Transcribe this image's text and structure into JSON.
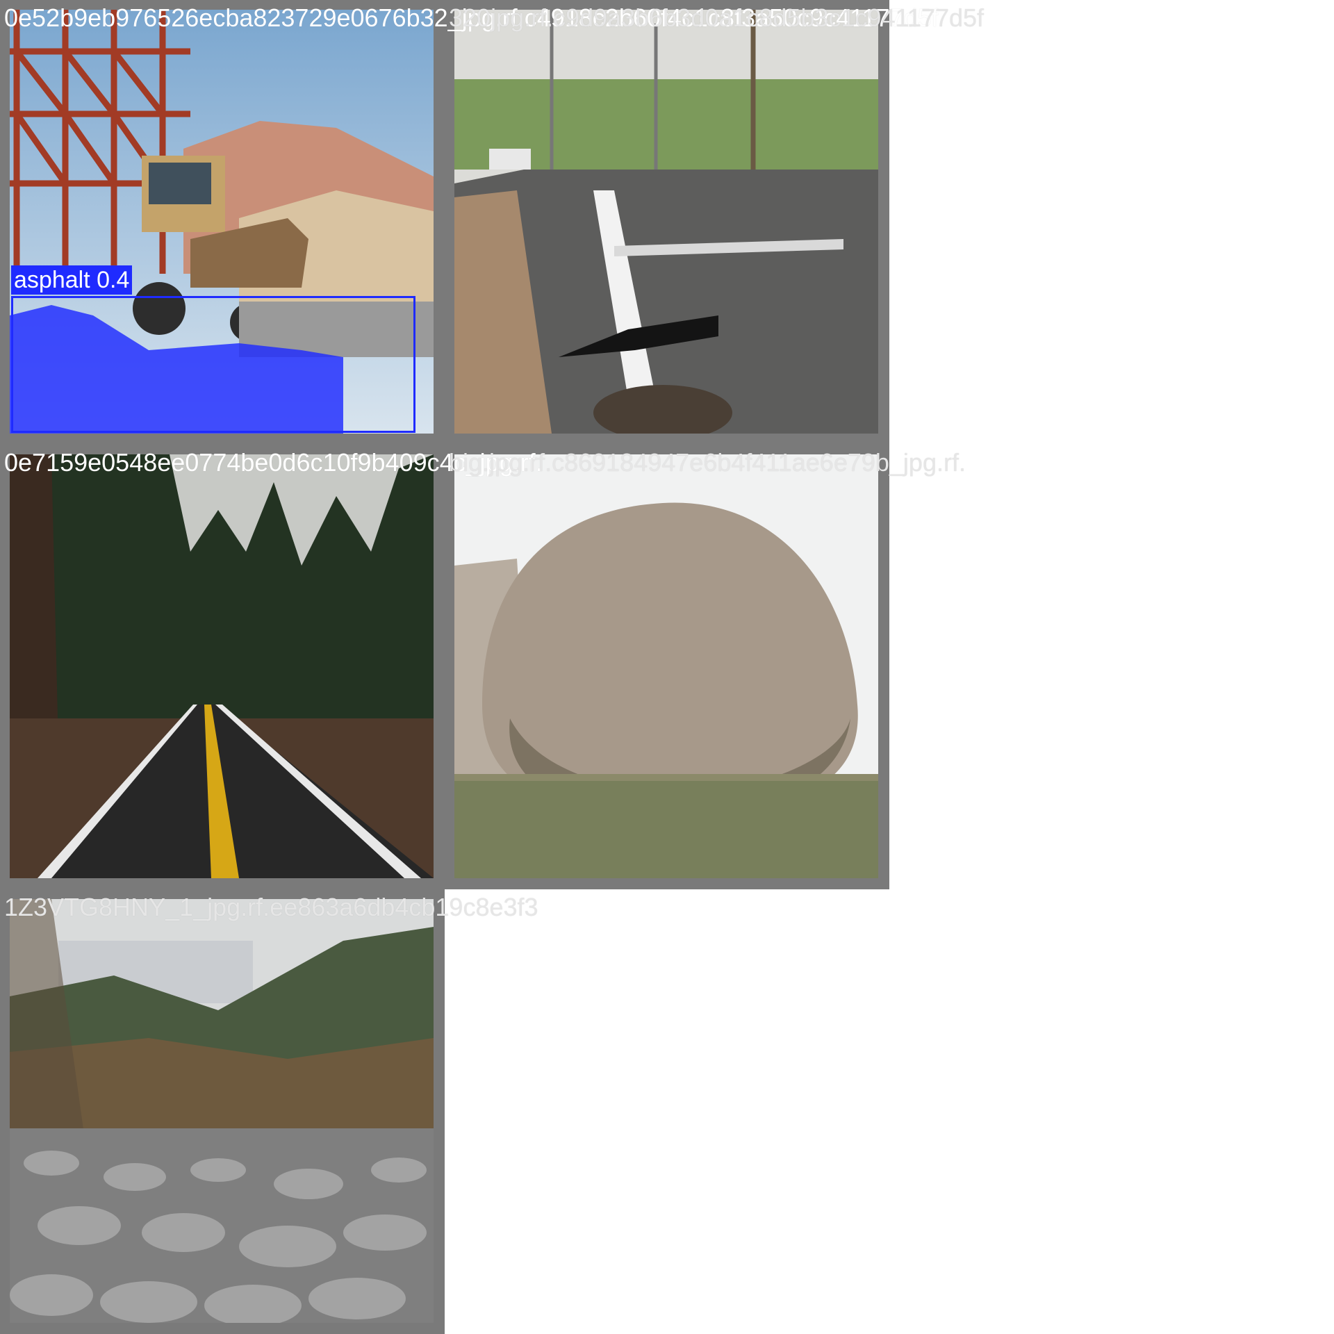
{
  "grid": {
    "tiles": [
      {
        "filename": "0e52b9eb976526ecba823729e0676b32_jpg.rf.c4918c2b60f4c1c8f3a50c9c41177d5f",
        "scene": "backhoe loader on construction site with gravel piles",
        "detections": [
          {
            "label": "asphalt 0.4",
            "color": "#1f2bff"
          }
        ]
      },
      {
        "filename": "320jpg.rf.c9d9a3b6b3d0a1c8d5b3c1c941177d5f",
        "scene": "damaged asphalt road intersection with pothole",
        "detections": []
      },
      {
        "filename": "0e7159e0548ee0774be0d6c10f9b409c4c_jpg.rf.",
        "scene": "forest road with double yellow center line",
        "detections": []
      },
      {
        "filename": "big.jpg.rf.c869184947e6b4f411ae6e79b_jpg.rf.",
        "scene": "large granite boulder in desert scrubland",
        "detections": []
      },
      {
        "filename": "1Z3VTG8HNY_1_jpg.rf.ee863a6db4cb19c8e3f3",
        "scene": "valley with rockfall debris and forested mountains",
        "detections": []
      }
    ]
  },
  "colors": {
    "tile_border": "#7a7a7a",
    "detection_fill": "#1f2bff",
    "caption_text": "#ffffff"
  }
}
